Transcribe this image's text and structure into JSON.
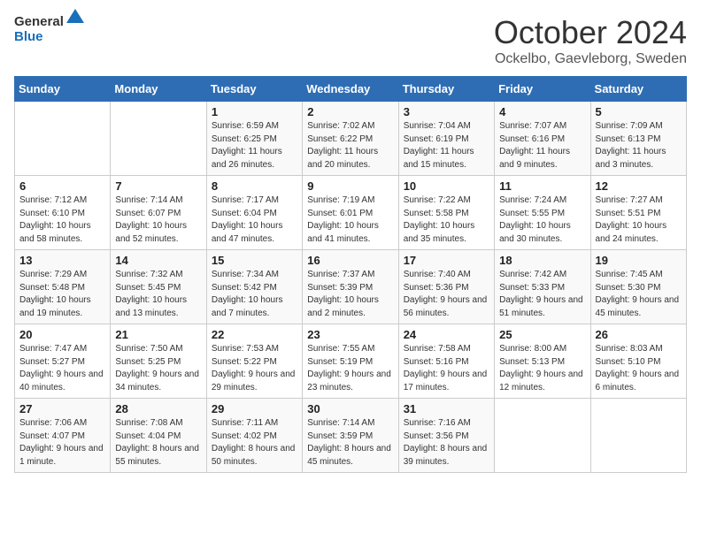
{
  "logo": {
    "general": "General",
    "blue": "Blue"
  },
  "title": {
    "month": "October 2024",
    "location": "Ockelbo, Gaevleborg, Sweden"
  },
  "headers": [
    "Sunday",
    "Monday",
    "Tuesday",
    "Wednesday",
    "Thursday",
    "Friday",
    "Saturday"
  ],
  "weeks": [
    [
      {
        "day": "",
        "info": ""
      },
      {
        "day": "",
        "info": ""
      },
      {
        "day": "1",
        "info": "Sunrise: 6:59 AM\nSunset: 6:25 PM\nDaylight: 11 hours and 26 minutes."
      },
      {
        "day": "2",
        "info": "Sunrise: 7:02 AM\nSunset: 6:22 PM\nDaylight: 11 hours and 20 minutes."
      },
      {
        "day": "3",
        "info": "Sunrise: 7:04 AM\nSunset: 6:19 PM\nDaylight: 11 hours and 15 minutes."
      },
      {
        "day": "4",
        "info": "Sunrise: 7:07 AM\nSunset: 6:16 PM\nDaylight: 11 hours and 9 minutes."
      },
      {
        "day": "5",
        "info": "Sunrise: 7:09 AM\nSunset: 6:13 PM\nDaylight: 11 hours and 3 minutes."
      }
    ],
    [
      {
        "day": "6",
        "info": "Sunrise: 7:12 AM\nSunset: 6:10 PM\nDaylight: 10 hours and 58 minutes."
      },
      {
        "day": "7",
        "info": "Sunrise: 7:14 AM\nSunset: 6:07 PM\nDaylight: 10 hours and 52 minutes."
      },
      {
        "day": "8",
        "info": "Sunrise: 7:17 AM\nSunset: 6:04 PM\nDaylight: 10 hours and 47 minutes."
      },
      {
        "day": "9",
        "info": "Sunrise: 7:19 AM\nSunset: 6:01 PM\nDaylight: 10 hours and 41 minutes."
      },
      {
        "day": "10",
        "info": "Sunrise: 7:22 AM\nSunset: 5:58 PM\nDaylight: 10 hours and 35 minutes."
      },
      {
        "day": "11",
        "info": "Sunrise: 7:24 AM\nSunset: 5:55 PM\nDaylight: 10 hours and 30 minutes."
      },
      {
        "day": "12",
        "info": "Sunrise: 7:27 AM\nSunset: 5:51 PM\nDaylight: 10 hours and 24 minutes."
      }
    ],
    [
      {
        "day": "13",
        "info": "Sunrise: 7:29 AM\nSunset: 5:48 PM\nDaylight: 10 hours and 19 minutes."
      },
      {
        "day": "14",
        "info": "Sunrise: 7:32 AM\nSunset: 5:45 PM\nDaylight: 10 hours and 13 minutes."
      },
      {
        "day": "15",
        "info": "Sunrise: 7:34 AM\nSunset: 5:42 PM\nDaylight: 10 hours and 7 minutes."
      },
      {
        "day": "16",
        "info": "Sunrise: 7:37 AM\nSunset: 5:39 PM\nDaylight: 10 hours and 2 minutes."
      },
      {
        "day": "17",
        "info": "Sunrise: 7:40 AM\nSunset: 5:36 PM\nDaylight: 9 hours and 56 minutes."
      },
      {
        "day": "18",
        "info": "Sunrise: 7:42 AM\nSunset: 5:33 PM\nDaylight: 9 hours and 51 minutes."
      },
      {
        "day": "19",
        "info": "Sunrise: 7:45 AM\nSunset: 5:30 PM\nDaylight: 9 hours and 45 minutes."
      }
    ],
    [
      {
        "day": "20",
        "info": "Sunrise: 7:47 AM\nSunset: 5:27 PM\nDaylight: 9 hours and 40 minutes."
      },
      {
        "day": "21",
        "info": "Sunrise: 7:50 AM\nSunset: 5:25 PM\nDaylight: 9 hours and 34 minutes."
      },
      {
        "day": "22",
        "info": "Sunrise: 7:53 AM\nSunset: 5:22 PM\nDaylight: 9 hours and 29 minutes."
      },
      {
        "day": "23",
        "info": "Sunrise: 7:55 AM\nSunset: 5:19 PM\nDaylight: 9 hours and 23 minutes."
      },
      {
        "day": "24",
        "info": "Sunrise: 7:58 AM\nSunset: 5:16 PM\nDaylight: 9 hours and 17 minutes."
      },
      {
        "day": "25",
        "info": "Sunrise: 8:00 AM\nSunset: 5:13 PM\nDaylight: 9 hours and 12 minutes."
      },
      {
        "day": "26",
        "info": "Sunrise: 8:03 AM\nSunset: 5:10 PM\nDaylight: 9 hours and 6 minutes."
      }
    ],
    [
      {
        "day": "27",
        "info": "Sunrise: 7:06 AM\nSunset: 4:07 PM\nDaylight: 9 hours and 1 minute."
      },
      {
        "day": "28",
        "info": "Sunrise: 7:08 AM\nSunset: 4:04 PM\nDaylight: 8 hours and 55 minutes."
      },
      {
        "day": "29",
        "info": "Sunrise: 7:11 AM\nSunset: 4:02 PM\nDaylight: 8 hours and 50 minutes."
      },
      {
        "day": "30",
        "info": "Sunrise: 7:14 AM\nSunset: 3:59 PM\nDaylight: 8 hours and 45 minutes."
      },
      {
        "day": "31",
        "info": "Sunrise: 7:16 AM\nSunset: 3:56 PM\nDaylight: 8 hours and 39 minutes."
      },
      {
        "day": "",
        "info": ""
      },
      {
        "day": "",
        "info": ""
      }
    ]
  ]
}
